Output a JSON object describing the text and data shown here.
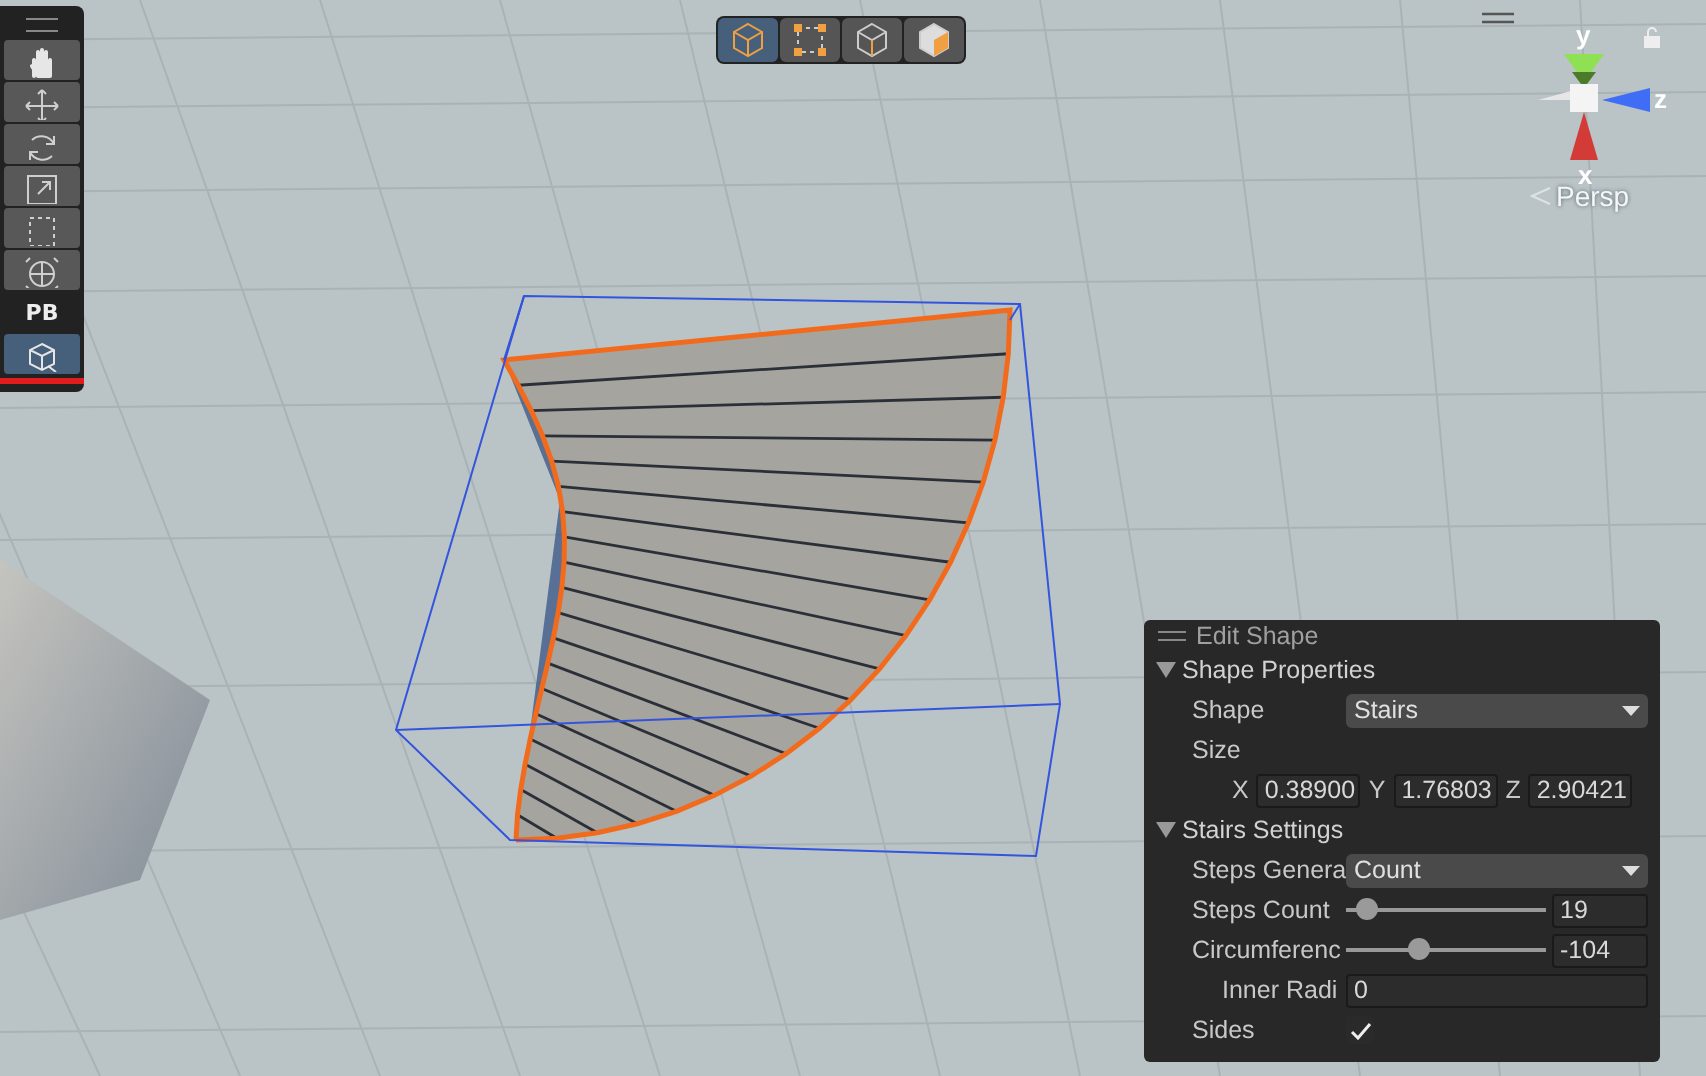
{
  "tool_palette": {
    "label": "PB",
    "tools": [
      {
        "kind": "hand",
        "selected": false
      },
      {
        "kind": "move",
        "selected": false
      },
      {
        "kind": "rotate",
        "selected": false
      },
      {
        "kind": "scale",
        "selected": false
      },
      {
        "kind": "rect",
        "selected": false
      },
      {
        "kind": "transform",
        "selected": false
      }
    ],
    "mode_tools": [
      {
        "kind": "cube-edit",
        "selected": true
      }
    ]
  },
  "view_modes": [
    {
      "kind": "object",
      "selected": true
    },
    {
      "kind": "vertex",
      "selected": false
    },
    {
      "kind": "edge",
      "selected": false
    },
    {
      "kind": "face",
      "selected": false
    }
  ],
  "gizmo": {
    "y_label": "y",
    "z_label": "z",
    "x_label": "x",
    "projection": "Persp"
  },
  "edit_shape": {
    "title": "Edit Shape",
    "sections": [
      {
        "title": "Shape Properties",
        "expanded": true,
        "rows": [
          {
            "kind": "dropdown",
            "label": "Shape",
            "value": "Stairs"
          },
          {
            "kind": "heading",
            "label": "Size"
          },
          {
            "kind": "vector",
            "fields": [
              {
                "axis": "X",
                "value": "0.38900"
              },
              {
                "axis": "Y",
                "value": "1.76803"
              },
              {
                "axis": "Z",
                "value": "2.90421"
              }
            ]
          }
        ]
      },
      {
        "title": "Stairs Settings",
        "expanded": true,
        "rows": [
          {
            "kind": "dropdown",
            "label": "Steps Genera",
            "value": "Count"
          },
          {
            "kind": "slider",
            "label": "Steps Count",
            "level": 0.1,
            "value": "19"
          },
          {
            "kind": "slider",
            "label": "Circumferenc",
            "level": 0.36,
            "value": "-104"
          },
          {
            "kind": "subfield",
            "label": "Inner Radi",
            "value": "0"
          },
          {
            "kind": "checkbox",
            "label": "Sides",
            "checked": true
          }
        ]
      }
    ]
  }
}
